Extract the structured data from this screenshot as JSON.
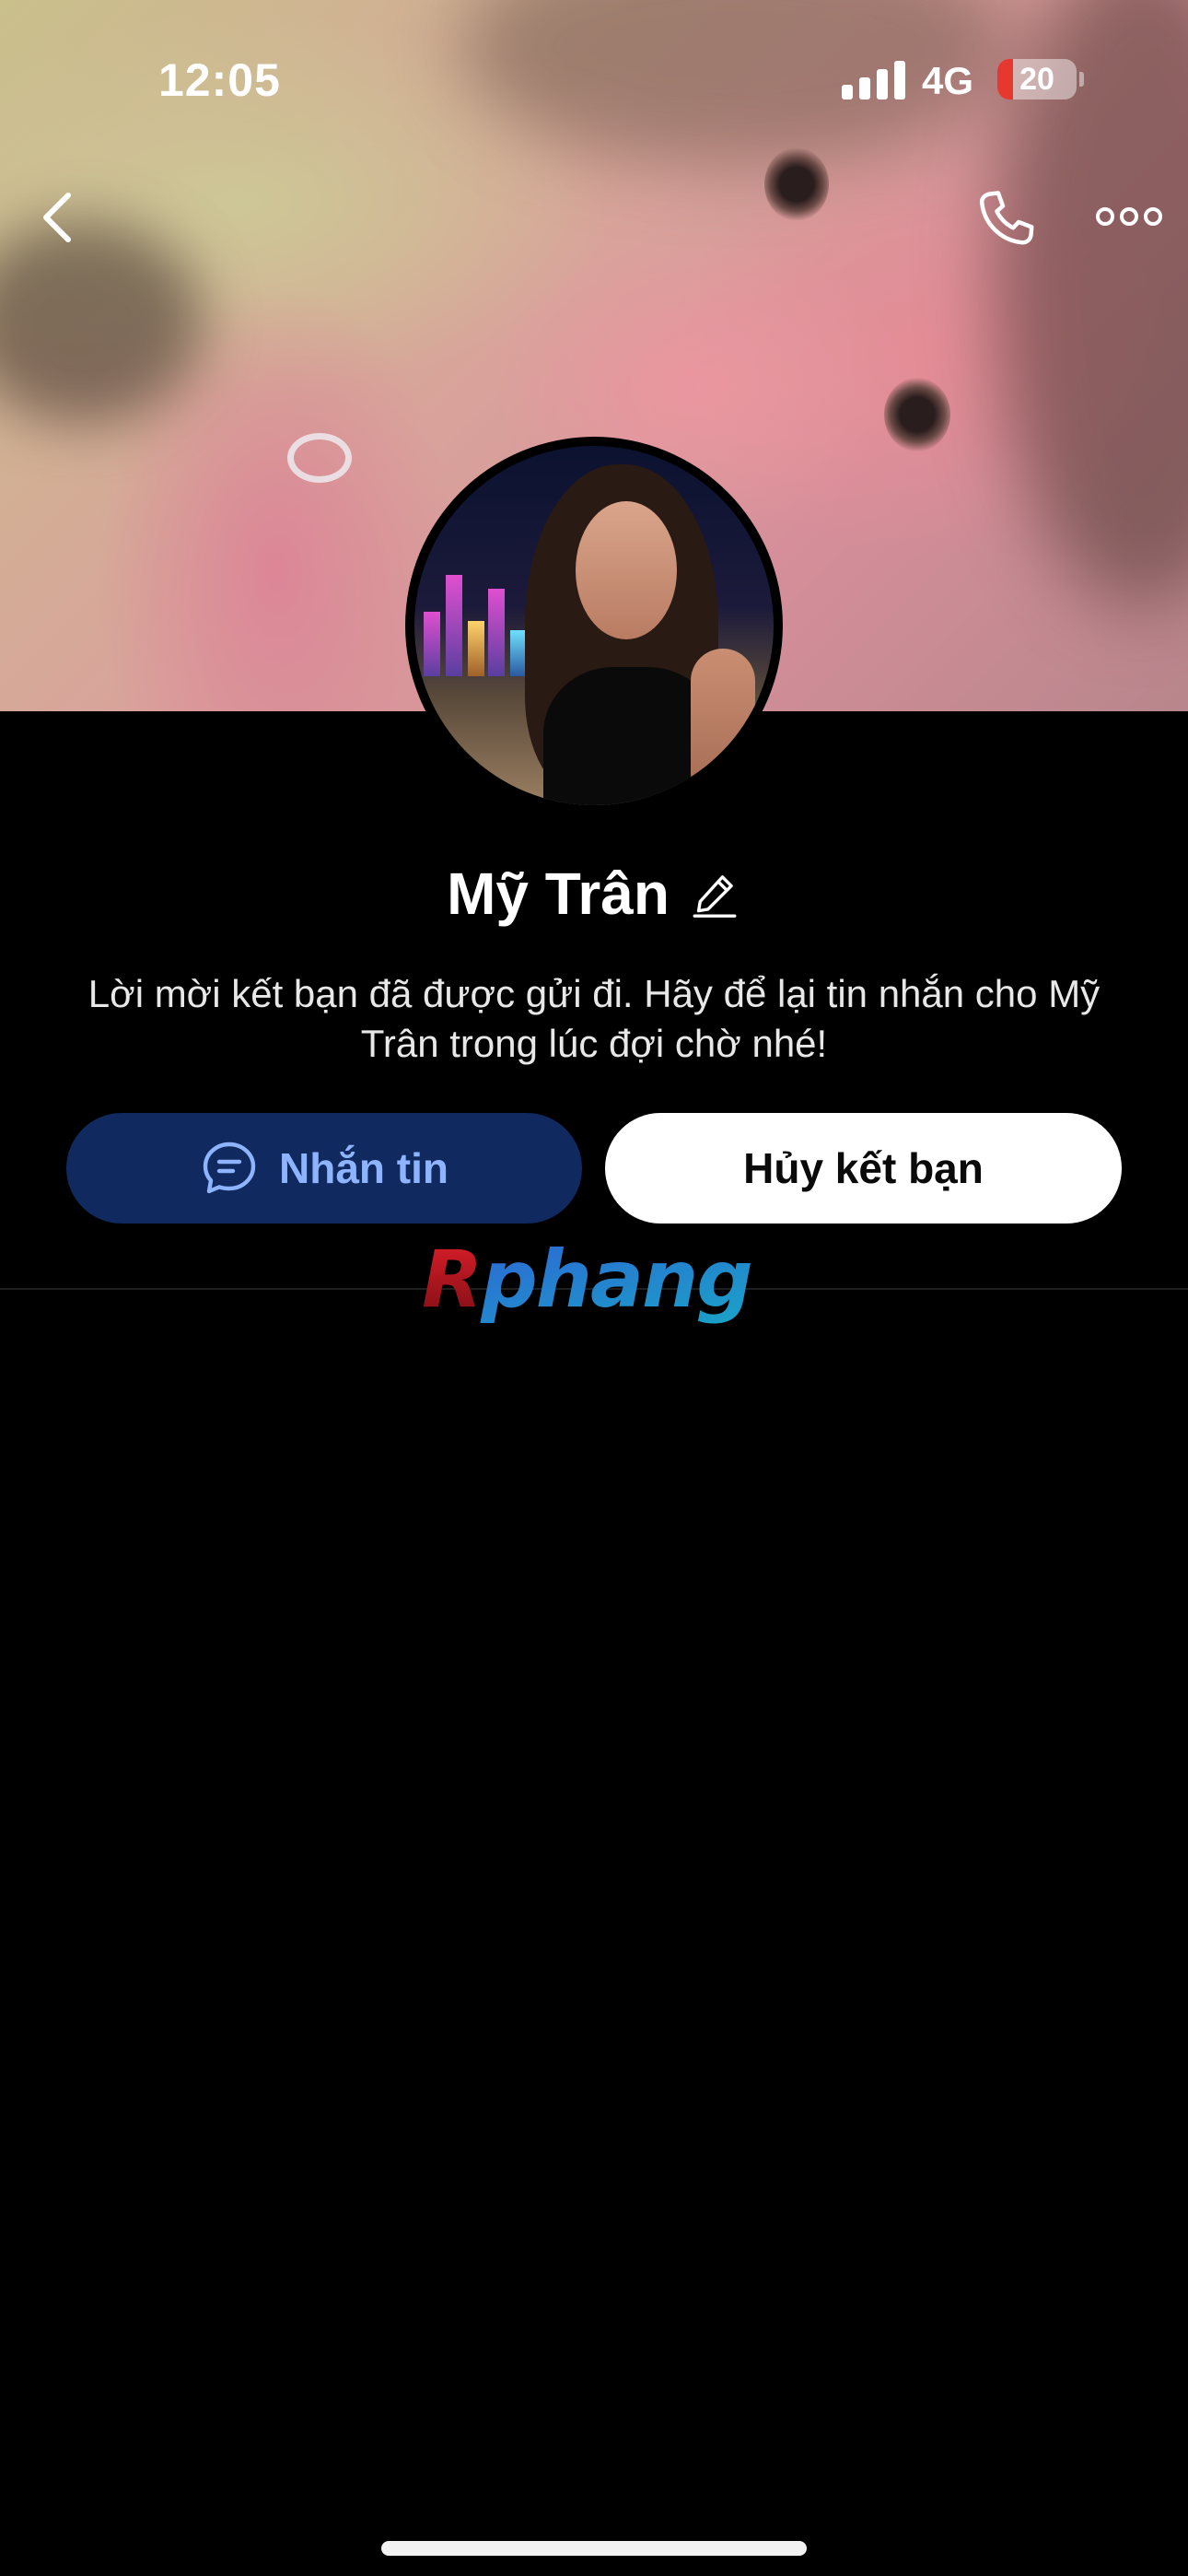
{
  "status_bar": {
    "time": "12:05",
    "network": "4G",
    "battery_level": "20",
    "battery_fraction": 0.2,
    "battery_color": "#e6382f"
  },
  "nav": {
    "back_icon": "chevron-left-icon",
    "call_icon": "phone-icon",
    "more_icon": "more-horizontal-icon"
  },
  "profile": {
    "name": "Mỹ Trân",
    "edit_icon": "pencil-icon",
    "message": "Lời mời kết bạn đã được gửi đi. Hãy để lại tin nhắn cho Mỹ Trân trong lúc đợi chờ nhé!"
  },
  "actions": {
    "message_button": "Nhắn tin",
    "message_icon": "chat-bubble-icon",
    "message_button_bg": "#10295e",
    "message_button_color": "#8fb4ff",
    "cancel_button": "Hủy kết bạn",
    "cancel_button_bg": "#ffffff"
  },
  "watermark": {
    "text": "Rphang"
  }
}
